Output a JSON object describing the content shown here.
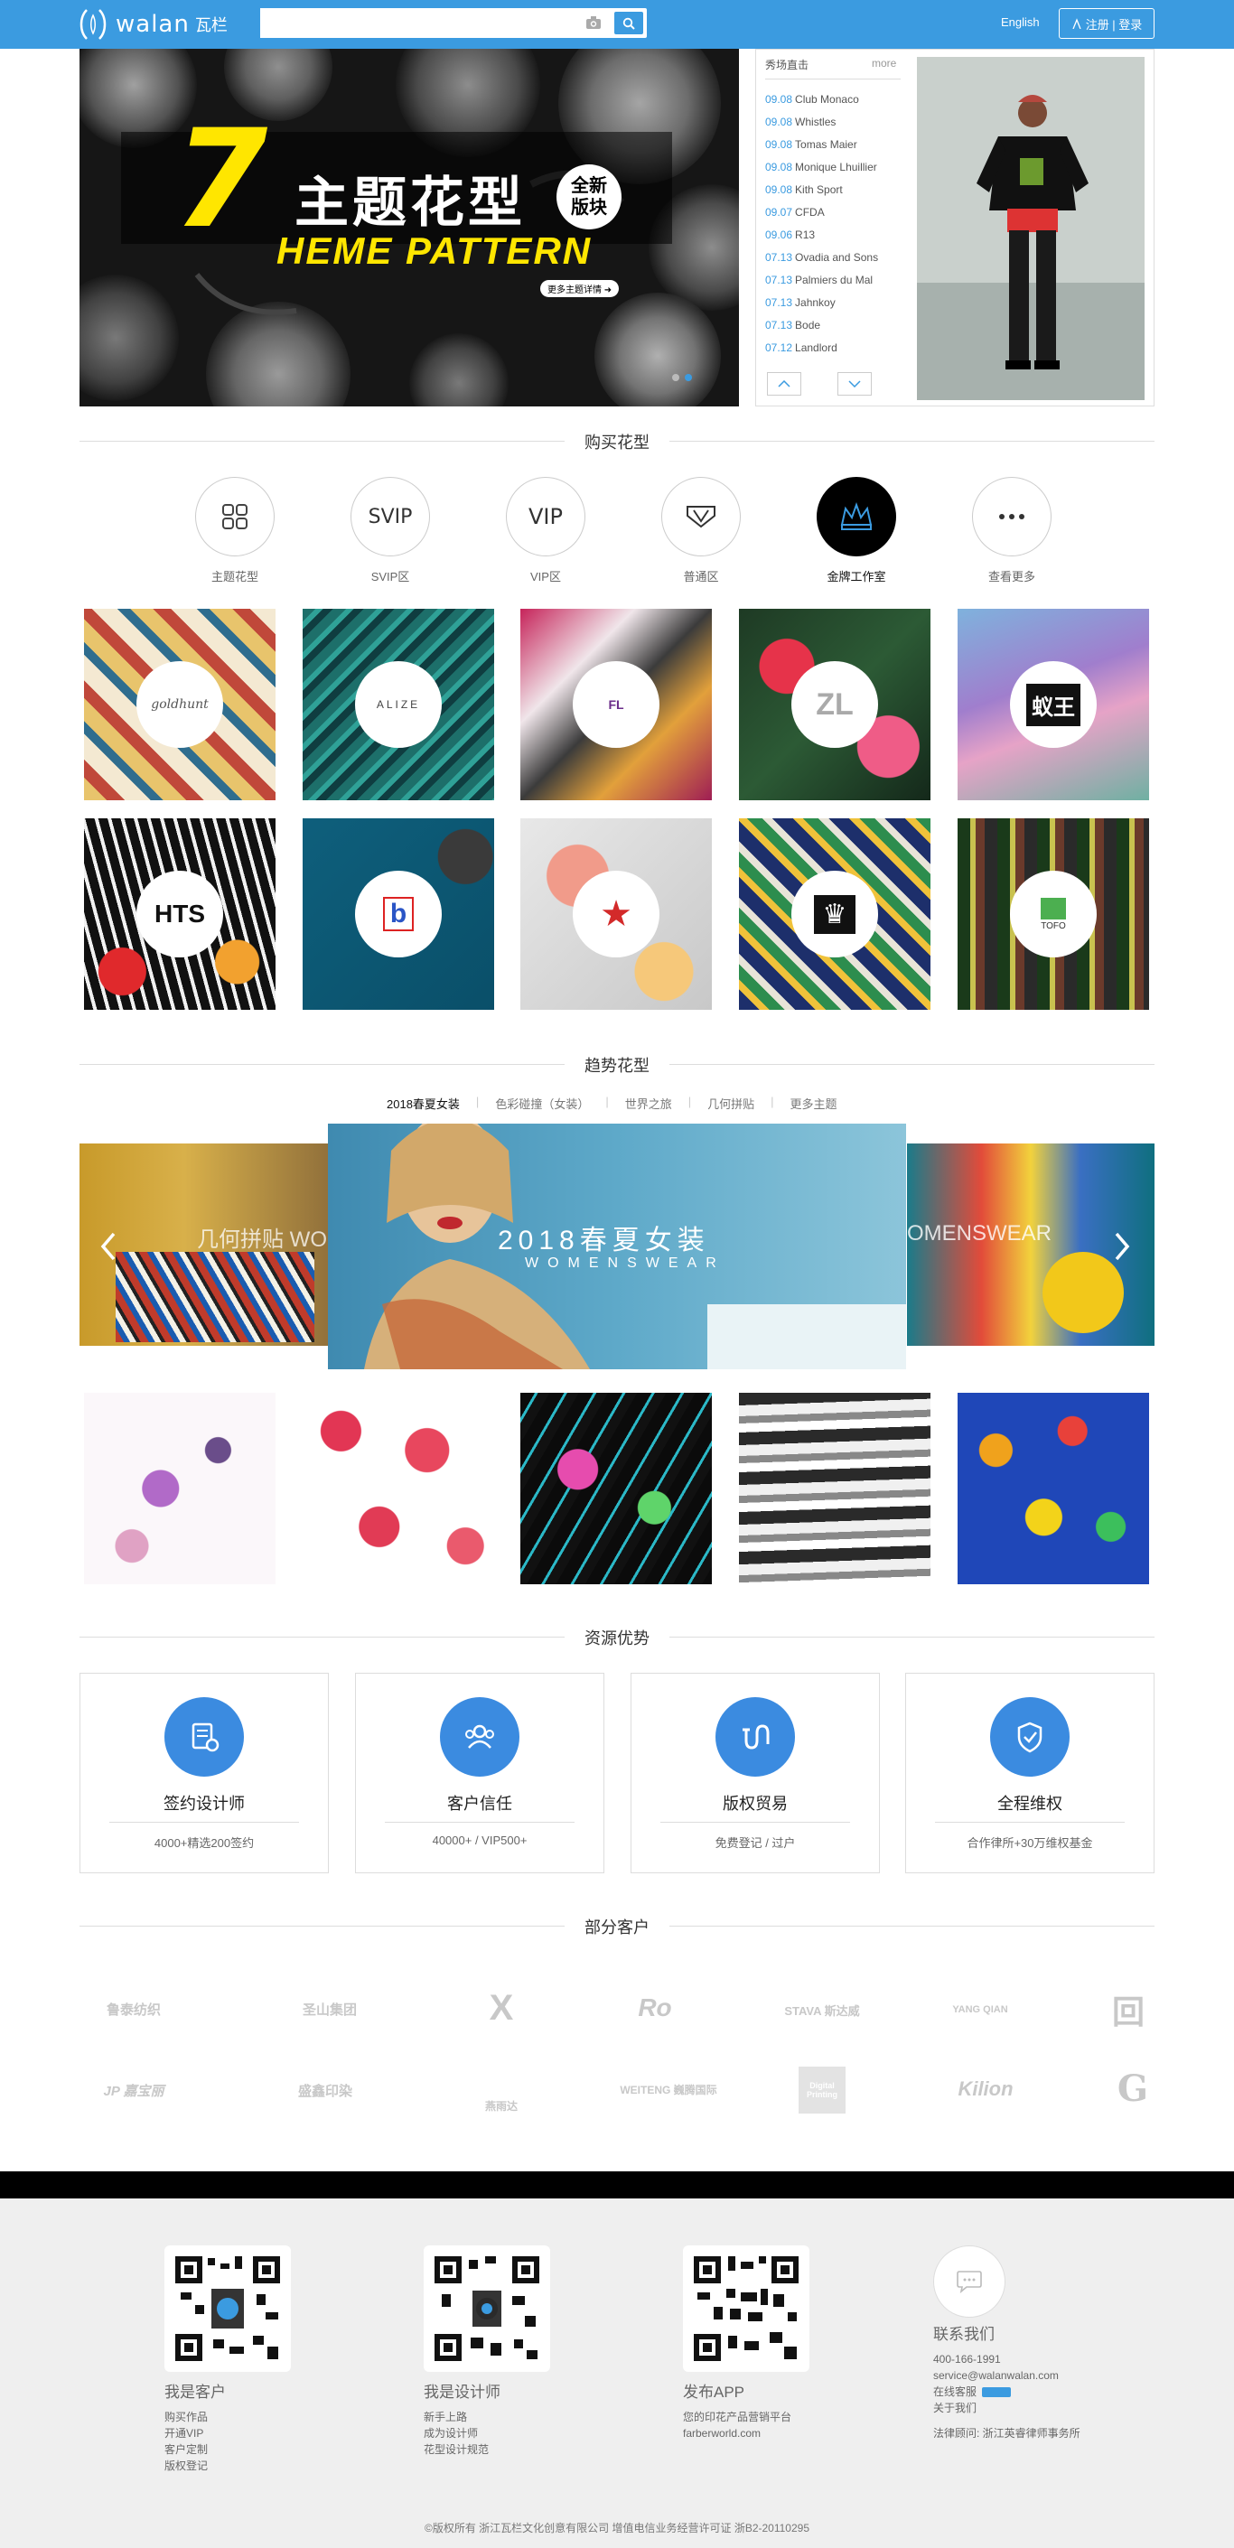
{
  "header": {
    "logo_text": "walan",
    "logo_cn": "瓦栏",
    "search_placeholder": "",
    "lang": "English",
    "login": "注册 | 登录"
  },
  "hero": {
    "number": "7",
    "title": "主题花型",
    "badge_line1": "全新",
    "badge_line2": "版块",
    "subtitle": "HEME PATTERN",
    "button": "更多主题详情 ➜"
  },
  "news": {
    "title": "秀场直击",
    "more": "more",
    "items": [
      {
        "date": "09.08",
        "name": "Club Monaco"
      },
      {
        "date": "09.08",
        "name": "Whistles"
      },
      {
        "date": "09.08",
        "name": "Tomas Maier"
      },
      {
        "date": "09.08",
        "name": "Monique Lhuillier"
      },
      {
        "date": "09.08",
        "name": "Kith Sport"
      },
      {
        "date": "09.07",
        "name": "CFDA"
      },
      {
        "date": "09.06",
        "name": "R13"
      },
      {
        "date": "07.13",
        "name": "Ovadia and Sons"
      },
      {
        "date": "07.13",
        "name": "Palmiers du Mal"
      },
      {
        "date": "07.13",
        "name": "Jahnkoy"
      },
      {
        "date": "07.13",
        "name": "Bode"
      },
      {
        "date": "07.12",
        "name": "Landlord"
      }
    ]
  },
  "buy": {
    "title": "购买花型",
    "cats": [
      {
        "label": "主题花型",
        "icon": "grid-icon"
      },
      {
        "label": "SVIP区",
        "icon": "svip-icon"
      },
      {
        "label": "VIP区",
        "icon": "vip-icon"
      },
      {
        "label": "普通区",
        "icon": "badge-icon"
      },
      {
        "label": "金牌工作室",
        "icon": "crown-icon"
      },
      {
        "label": "查看更多",
        "icon": "more-icon"
      }
    ],
    "studio_logos": [
      "goldhunt",
      "ALIZE",
      "FL",
      "ZL",
      "蚁王",
      "HTS",
      "b",
      "★",
      "♛",
      "TOFO"
    ]
  },
  "trend": {
    "title": "趋势花型",
    "tabs": [
      "2018春夏女装",
      "色彩碰撞（女装）",
      "世界之旅",
      "几何拼贴",
      "更多主题"
    ],
    "slide_main_title": "2018春夏女装",
    "slide_main_sub": "WOMENSWEAR",
    "slide_left_title": "几何拼贴 WOM",
    "slide_right_title": "OMENSWEAR"
  },
  "advantages": {
    "title": "资源优势",
    "items": [
      {
        "title": "签约设计师",
        "sub": "4000+精选200签约"
      },
      {
        "title": "客户信任",
        "sub": "40000+ / VIP500+"
      },
      {
        "title": "版权贸易",
        "sub": "免费登记 / 过户"
      },
      {
        "title": "全程维权",
        "sub": "合作律所+30万维权基金"
      }
    ]
  },
  "clients": {
    "title": "部分客户",
    "row1": [
      "鲁泰纺织",
      "圣山集团",
      "X",
      "Ro",
      "STAVA 斯达威",
      "YANG QIAN",
      "回"
    ],
    "row2": [
      "JP 嘉宝丽",
      "盛鑫印染",
      "燕雨达",
      "WEITENG 巍腾国际",
      "Digital Printing",
      "Kilion",
      "G"
    ]
  },
  "footer": {
    "cols": [
      {
        "title": "我是客户",
        "items": [
          "购买作品",
          "开通VIP",
          "客户定制",
          "版权登记"
        ]
      },
      {
        "title": "我是设计师",
        "items": [
          "新手上路",
          "成为设计师",
          "花型设计规范"
        ]
      },
      {
        "title": "发布APP",
        "items": [
          "您的印花产品营销平台",
          "farberworld.com"
        ]
      },
      {
        "title": "联系我们",
        "items": [
          "400-166-1991",
          "service@walanwalan.com",
          "在线客服",
          "关于我们"
        ],
        "lawyer": "法律顾问: 浙江英睿律师事务所"
      }
    ],
    "copyright": "©版权所有 浙江瓦栏文化创意有限公司 增值电信业务经营许可证 浙B2-20110295"
  }
}
